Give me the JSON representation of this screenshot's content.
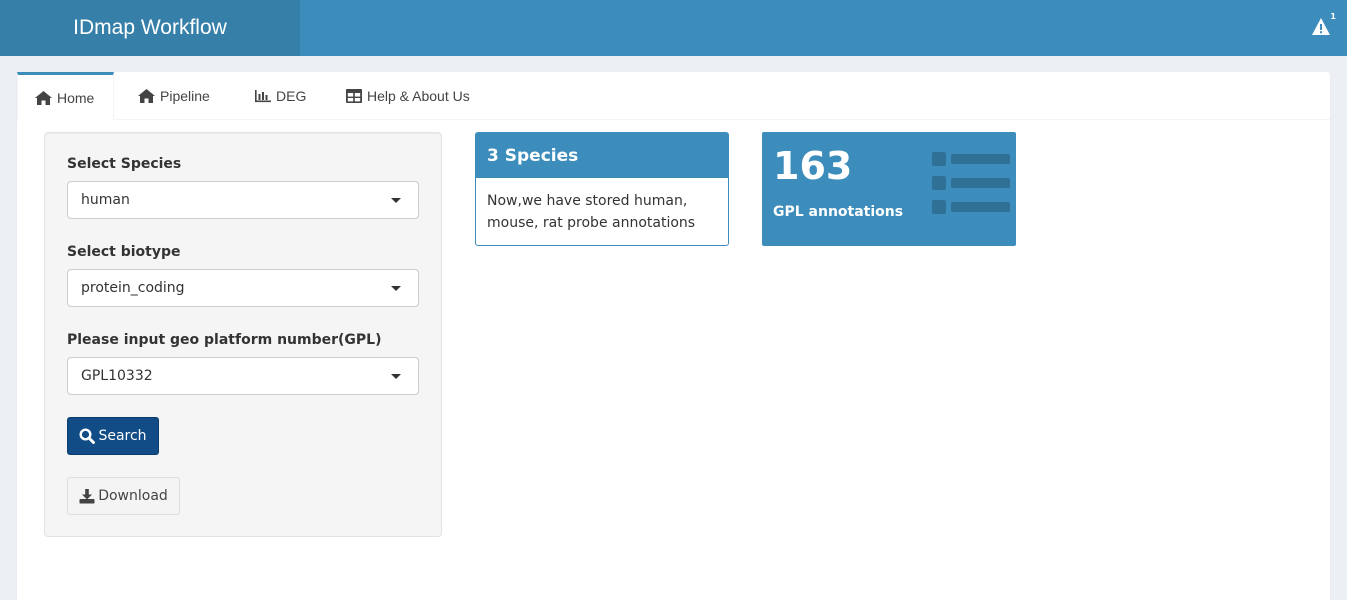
{
  "header": {
    "title": "IDmap Workflow",
    "notification_count": "1"
  },
  "tabs": [
    {
      "label": "Home",
      "icon": "home-icon",
      "active": true
    },
    {
      "label": "Pipeline",
      "icon": "home-icon"
    },
    {
      "label": "DEG",
      "icon": "bar-chart-icon"
    },
    {
      "label": "Help & About Us",
      "icon": "table-icon"
    }
  ],
  "form": {
    "species_label": "Select Species",
    "species_value": "human",
    "biotype_label": "Select biotype",
    "biotype_value": "protein_coding",
    "gpl_label": "Please input geo platform number(GPL)",
    "gpl_value": "GPL10332",
    "search_label": "Search",
    "download_label": "Download"
  },
  "species_box": {
    "title": "3 Species",
    "body": "Now,we have stored human, mouse, rat probe annotations"
  },
  "value_box": {
    "value": "163",
    "subtitle": "GPL annotations",
    "icon": "list-icon"
  },
  "colors": {
    "primary": "#3c8dbc",
    "logo_bg": "#367fa9",
    "search_button": "#114c87"
  }
}
